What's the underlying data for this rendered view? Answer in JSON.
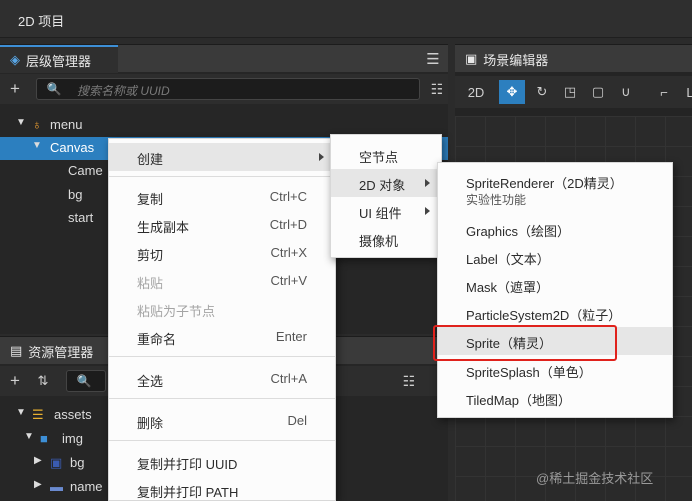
{
  "app": {
    "title": "2D 项目"
  },
  "hierarchy": {
    "tab_label": "层级管理器",
    "search_placeholder": "搜索名称或 UUID",
    "nodes": [
      "menu",
      "Canvas",
      "Came",
      "bg",
      "start"
    ]
  },
  "assets": {
    "tab_label": "资源管理器",
    "nodes": [
      "assets",
      "img",
      "bg",
      "name"
    ]
  },
  "scene": {
    "tab_label": "场景编辑器",
    "tools": [
      "2D",
      "move",
      "rotate",
      "scale",
      "rect",
      "transform",
      "anchor",
      "layout"
    ]
  },
  "context_menu": {
    "items": [
      {
        "label": "创建",
        "shortcut": "",
        "submenu": true
      },
      {
        "label": "复制",
        "shortcut": "Ctrl+C"
      },
      {
        "label": "生成副本",
        "shortcut": "Ctrl+D"
      },
      {
        "label": "剪切",
        "shortcut": "Ctrl+X"
      },
      {
        "label": "粘贴",
        "shortcut": "Ctrl+V",
        "disabled": true
      },
      {
        "label": "粘贴为子节点",
        "shortcut": "",
        "disabled": true
      },
      {
        "label": "重命名",
        "shortcut": "Enter"
      },
      {
        "label": "全选",
        "shortcut": "Ctrl+A"
      },
      {
        "label": "删除",
        "shortcut": "Del"
      },
      {
        "label": "复制并打印 UUID",
        "shortcut": ""
      },
      {
        "label": "复制并打印 PATH",
        "shortcut": ""
      }
    ]
  },
  "create_submenu": {
    "items": [
      "空节点",
      "2D 对象",
      "UI 组件",
      "摄像机"
    ]
  },
  "object2d_submenu": {
    "items": [
      {
        "label": "SpriteRenderer（2D精灵）",
        "note": "实验性功能"
      },
      {
        "label": "Graphics（绘图）"
      },
      {
        "label": "Label（文本）"
      },
      {
        "label": "Mask（遮罩）"
      },
      {
        "label": "ParticleSystem2D（粒子）"
      },
      {
        "label": "Sprite（精灵）",
        "highlighted": true
      },
      {
        "label": "SpriteSplash（单色）"
      },
      {
        "label": "TiledMap（地图）"
      }
    ]
  },
  "watermark": "@稀土掘金技术社区",
  "colors": {
    "selection": "#2c7fbf",
    "highlight_box": "#e0221c",
    "accent": "#3d8fd6"
  }
}
